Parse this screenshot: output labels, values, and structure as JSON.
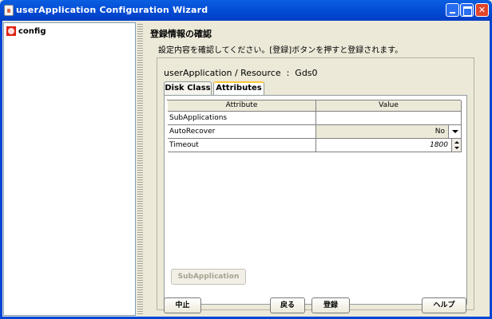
{
  "window": {
    "title": "userApplication Configuration Wizard"
  },
  "tree": {
    "items": [
      {
        "label": "config"
      }
    ]
  },
  "header": {
    "title": "登録情報の確認",
    "description": "設定内容を確認してください。[登録]ボタンを押すと登録されます。"
  },
  "resource": {
    "title": "userApplication / Resource  :  Gds0"
  },
  "tabs": [
    {
      "label": "Disk Class",
      "selected": false
    },
    {
      "label": "Attributes",
      "selected": true
    }
  ],
  "table": {
    "columns": [
      "Attribute",
      "Value"
    ],
    "rows": [
      {
        "attribute": "SubApplications",
        "value": ""
      },
      {
        "attribute": "AutoRecover",
        "value": "No"
      },
      {
        "attribute": "Timeout",
        "value": "1800"
      }
    ]
  },
  "subapp_button": {
    "label": "SubApplication",
    "enabled": false
  },
  "buttons": {
    "cancel": "中止",
    "back": "戻る",
    "register": "登録",
    "help": "ヘルプ"
  },
  "colors": {
    "titlebar": "#0553d8",
    "background": "#ece9d8",
    "tab_highlight": "#ffc73c"
  }
}
